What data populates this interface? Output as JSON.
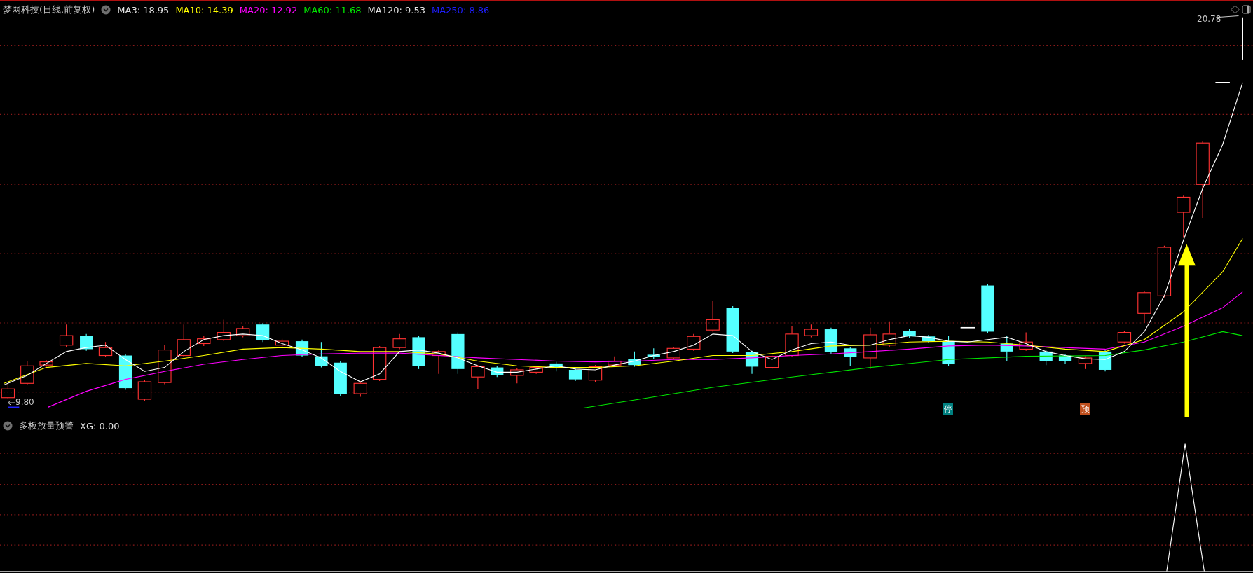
{
  "main_panel": {
    "title": "梦网科技(日线.前复权)",
    "indicators": [
      {
        "text": "MA3: 18.95",
        "color": "#e0e0e0"
      },
      {
        "text": "MA10: 14.39",
        "color": "#ffff00"
      },
      {
        "text": "MA20: 12.92",
        "color": "#ff00ff"
      },
      {
        "text": "MA60: 11.68",
        "color": "#00e600"
      },
      {
        "text": "MA120: 9.53",
        "color": "#e0e0e0"
      },
      {
        "text": "MA250: 8.86",
        "color": "#1e1eff"
      }
    ],
    "high_label": "20.78",
    "low_label": "9.80",
    "markers": [
      {
        "text": "停",
        "color": "#008080"
      },
      {
        "text": "预",
        "color": "#c0501e"
      }
    ]
  },
  "lower_panel": {
    "title": "多板放量预警",
    "indicators": [
      {
        "text": "XG: 0.00",
        "color": "#e0e0e0"
      }
    ]
  }
}
